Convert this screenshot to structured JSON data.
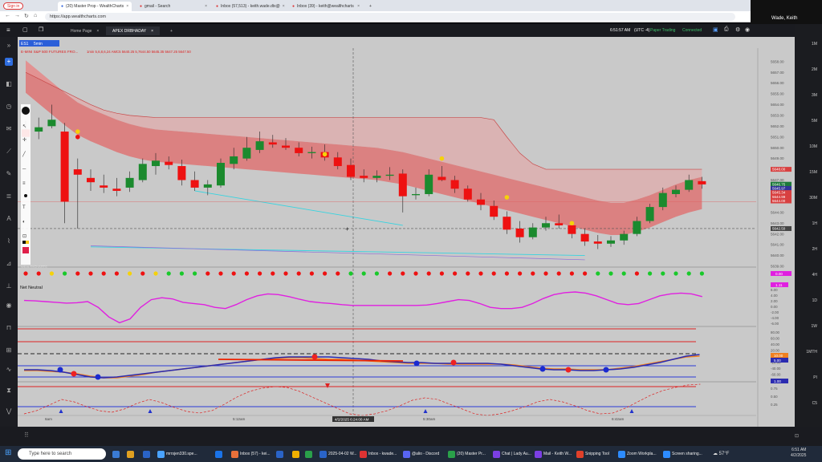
{
  "browser": {
    "sign_in": "Sign in",
    "tabs": [
      {
        "label": "(20) Master Prop - WealthCharts",
        "active": true
      },
      {
        "label": "gmail - Search",
        "active": false
      },
      {
        "label": "Inbox (57,513) - keith.wade.dtx@",
        "active": false
      },
      {
        "label": "Inbox (39) - keith@wealthcharts",
        "active": false
      }
    ],
    "new_tab": "+",
    "url": "https://app.wealthcharts.com"
  },
  "zoom": {
    "participant": "Wade, Keith"
  },
  "app": {
    "tabs": [
      {
        "label": "Home Page",
        "active": false
      },
      {
        "label": "APEX DRBHADAY",
        "active": true
      }
    ],
    "add_tab": "+",
    "time": "6:51:57 AM",
    "timezone": "(UTC -4)",
    "paper_trading": "Paper Trading",
    "connected": "Connected",
    "symbol": "ES1",
    "timeframe": "5min",
    "instrument_title": "E-MINI S&P 500 FUTURES FRO...",
    "title_values": "1min  5,6,8,6,24  AMC5  5640.25  5,7644.50  5645.35  5647.25  5647.50",
    "watermark": "WEALTHCHARTS",
    "net_neutral": "Net Neutral",
    "crosshair_date": "4/2/2025 6:24:00 AM",
    "time_labels": [
      "6am",
      "5:12am",
      "5:30am",
      "6:42am"
    ],
    "price_labels": [
      "5658.00",
      "5657.00",
      "5656.00",
      "5655.00",
      "5654.00",
      "5653.00",
      "5652.00",
      "5651.00",
      "5650.00",
      "5649.00",
      "5648.00",
      "5647.00",
      "5646.00",
      "5645.00",
      "5644.00",
      "5643.00",
      "5642.00",
      "5641.00",
      "5640.00",
      "5639.00"
    ],
    "price_tags": [
      {
        "value": "5648.00",
        "color": "#d84040"
      },
      {
        "value": "5646.75",
        "color": "#1c7a3a"
      },
      {
        "value": "5645.97",
        "color": "#333399"
      },
      {
        "value": "5645.34",
        "color": "#d84040"
      },
      {
        "value": "5644.99",
        "color": "#d84040"
      },
      {
        "value": "5644.00",
        "color": "#d84040"
      },
      {
        "value": "5642.50",
        "color": "#444"
      }
    ],
    "osc1_labels": [
      "8.00",
      "6.00",
      "4.00",
      "2.00",
      "0.00",
      "-2.00",
      "-4.00",
      "-6.00"
    ],
    "osc1_tag": "1.11",
    "osc2_labels": [
      "80.00",
      "60.00",
      "40.00",
      "20.00",
      "0.00",
      "-20.00",
      "-40.00",
      "-60.00"
    ],
    "osc2_tags": [
      "10.00",
      "5.00"
    ],
    "osc3_labels": [
      "0.75",
      "0.50",
      "0.25"
    ],
    "osc3_tag": "1.00",
    "top_right_tag": "0.00",
    "right_panel": [
      "1M",
      "2M",
      "3M",
      "5M",
      "10M",
      "15M",
      "30M",
      "1H",
      "2H",
      "4H",
      "1D",
      "1W",
      "1MTH",
      "PI",
      "C5"
    ]
  },
  "chart_data": {
    "type": "candlestick",
    "series": [
      {
        "name": "ES1 5min",
        "ohlc_note": "price candles"
      }
    ],
    "y_unit": "price",
    "visible_price_range": [
      5639,
      5658
    ],
    "candles": [
      {
        "o": 5651.0,
        "h": 5652.5,
        "l": 5650.5,
        "c": 5651.7,
        "dir": "down"
      },
      {
        "o": 5651.5,
        "h": 5652.8,
        "l": 5650.8,
        "c": 5651.9,
        "dir": "up"
      },
      {
        "o": 5652.0,
        "h": 5654.0,
        "l": 5651.8,
        "c": 5652.6,
        "dir": "up"
      },
      {
        "o": 5651.5,
        "h": 5652.3,
        "l": 5643.0,
        "c": 5645.0,
        "dir": "down"
      },
      {
        "o": 5648.0,
        "h": 5649.0,
        "l": 5642.5,
        "c": 5647.5,
        "dir": "down"
      },
      {
        "o": 5647.2,
        "h": 5648.0,
        "l": 5646.0,
        "c": 5646.8,
        "dir": "down"
      },
      {
        "o": 5646.5,
        "h": 5647.5,
        "l": 5645.8,
        "c": 5646.3,
        "dir": "down"
      },
      {
        "o": 5646.0,
        "h": 5647.2,
        "l": 5645.5,
        "c": 5646.2,
        "dir": "down"
      },
      {
        "o": 5646.3,
        "h": 5647.8,
        "l": 5645.9,
        "c": 5647.2,
        "dir": "up"
      },
      {
        "o": 5647.0,
        "h": 5649.0,
        "l": 5646.8,
        "c": 5648.5,
        "dir": "up"
      },
      {
        "o": 5648.3,
        "h": 5649.5,
        "l": 5647.5,
        "c": 5648.8,
        "dir": "up"
      },
      {
        "o": 5648.7,
        "h": 5649.2,
        "l": 5648.0,
        "c": 5648.4,
        "dir": "down"
      },
      {
        "o": 5648.3,
        "h": 5648.9,
        "l": 5646.5,
        "c": 5647.0,
        "dir": "down"
      },
      {
        "o": 5647.0,
        "h": 5647.8,
        "l": 5646.0,
        "c": 5646.3,
        "dir": "down"
      },
      {
        "o": 5646.3,
        "h": 5647.0,
        "l": 5645.6,
        "c": 5646.6,
        "dir": "up"
      },
      {
        "o": 5646.5,
        "h": 5649.0,
        "l": 5646.3,
        "c": 5648.6,
        "dir": "up"
      },
      {
        "o": 5648.5,
        "h": 5650.0,
        "l": 5648.0,
        "c": 5649.2,
        "dir": "up"
      },
      {
        "o": 5649.0,
        "h": 5651.0,
        "l": 5648.8,
        "c": 5650.0,
        "dir": "up"
      },
      {
        "o": 5649.8,
        "h": 5651.5,
        "l": 5649.5,
        "c": 5650.6,
        "dir": "up"
      },
      {
        "o": 5650.5,
        "h": 5651.2,
        "l": 5650.0,
        "c": 5650.3,
        "dir": "down"
      },
      {
        "o": 5650.2,
        "h": 5650.9,
        "l": 5649.8,
        "c": 5650.0,
        "dir": "down"
      },
      {
        "o": 5650.0,
        "h": 5650.5,
        "l": 5649.2,
        "c": 5649.5,
        "dir": "down"
      },
      {
        "o": 5649.5,
        "h": 5650.1,
        "l": 5649.0,
        "c": 5649.6,
        "dir": "up"
      },
      {
        "o": 5649.6,
        "h": 5650.3,
        "l": 5648.8,
        "c": 5649.1,
        "dir": "down"
      },
      {
        "o": 5649.1,
        "h": 5649.6,
        "l": 5648.0,
        "c": 5648.3,
        "dir": "down"
      },
      {
        "o": 5648.4,
        "h": 5649.0,
        "l": 5647.0,
        "c": 5647.3,
        "dir": "down"
      },
      {
        "o": 5647.4,
        "h": 5648.0,
        "l": 5646.8,
        "c": 5647.2,
        "dir": "down"
      },
      {
        "o": 5647.2,
        "h": 5647.9,
        "l": 5646.8,
        "c": 5647.4,
        "dir": "up"
      },
      {
        "o": 5647.4,
        "h": 5648.2,
        "l": 5647.0,
        "c": 5647.5,
        "dir": "up"
      },
      {
        "o": 5647.6,
        "h": 5648.0,
        "l": 5644.0,
        "c": 5645.5,
        "dir": "down"
      },
      {
        "o": 5645.6,
        "h": 5646.3,
        "l": 5645.2,
        "c": 5645.7,
        "dir": "up"
      },
      {
        "o": 5645.7,
        "h": 5648.0,
        "l": 5645.5,
        "c": 5647.5,
        "dir": "up"
      },
      {
        "o": 5647.3,
        "h": 5648.3,
        "l": 5646.9,
        "c": 5647.0,
        "dir": "down"
      },
      {
        "o": 5647.0,
        "h": 5647.4,
        "l": 5645.8,
        "c": 5646.2,
        "dir": "down"
      },
      {
        "o": 5646.2,
        "h": 5646.5,
        "l": 5645.0,
        "c": 5645.2,
        "dir": "down"
      },
      {
        "o": 5645.2,
        "h": 5645.8,
        "l": 5644.2,
        "c": 5644.7,
        "dir": "down"
      },
      {
        "o": 5644.6,
        "h": 5645.1,
        "l": 5643.3,
        "c": 5643.6,
        "dir": "down"
      },
      {
        "o": 5643.6,
        "h": 5644.1,
        "l": 5642.0,
        "c": 5642.4,
        "dir": "down"
      },
      {
        "o": 5642.5,
        "h": 5643.2,
        "l": 5641.2,
        "c": 5641.7,
        "dir": "down"
      },
      {
        "o": 5641.7,
        "h": 5643.0,
        "l": 5641.5,
        "c": 5642.6,
        "dir": "up"
      },
      {
        "o": 5642.6,
        "h": 5643.6,
        "l": 5642.3,
        "c": 5643.0,
        "dir": "up"
      },
      {
        "o": 5643.0,
        "h": 5643.8,
        "l": 5642.5,
        "c": 5642.8,
        "dir": "down"
      },
      {
        "o": 5642.8,
        "h": 5643.2,
        "l": 5641.6,
        "c": 5642.0,
        "dir": "down"
      },
      {
        "o": 5642.0,
        "h": 5642.5,
        "l": 5640.9,
        "c": 5641.3,
        "dir": "down"
      },
      {
        "o": 5641.3,
        "h": 5641.9,
        "l": 5640.6,
        "c": 5641.1,
        "dir": "down"
      },
      {
        "o": 5641.1,
        "h": 5641.8,
        "l": 5640.8,
        "c": 5641.4,
        "dir": "up"
      },
      {
        "o": 5641.4,
        "h": 5642.3,
        "l": 5641.0,
        "c": 5642.0,
        "dir": "up"
      },
      {
        "o": 5642.0,
        "h": 5643.6,
        "l": 5641.8,
        "c": 5643.2,
        "dir": "up"
      },
      {
        "o": 5643.2,
        "h": 5644.8,
        "l": 5643.0,
        "c": 5644.5,
        "dir": "up"
      },
      {
        "o": 5644.5,
        "h": 5646.3,
        "l": 5644.2,
        "c": 5645.8,
        "dir": "up"
      },
      {
        "o": 5645.7,
        "h": 5646.5,
        "l": 5645.4,
        "c": 5646.1,
        "dir": "up"
      },
      {
        "o": 5646.1,
        "h": 5647.5,
        "l": 5645.9,
        "c": 5647.0,
        "dir": "up"
      },
      {
        "o": 5646.9,
        "h": 5647.3,
        "l": 5646.2,
        "c": 5646.6,
        "dir": "down"
      }
    ]
  }
}
